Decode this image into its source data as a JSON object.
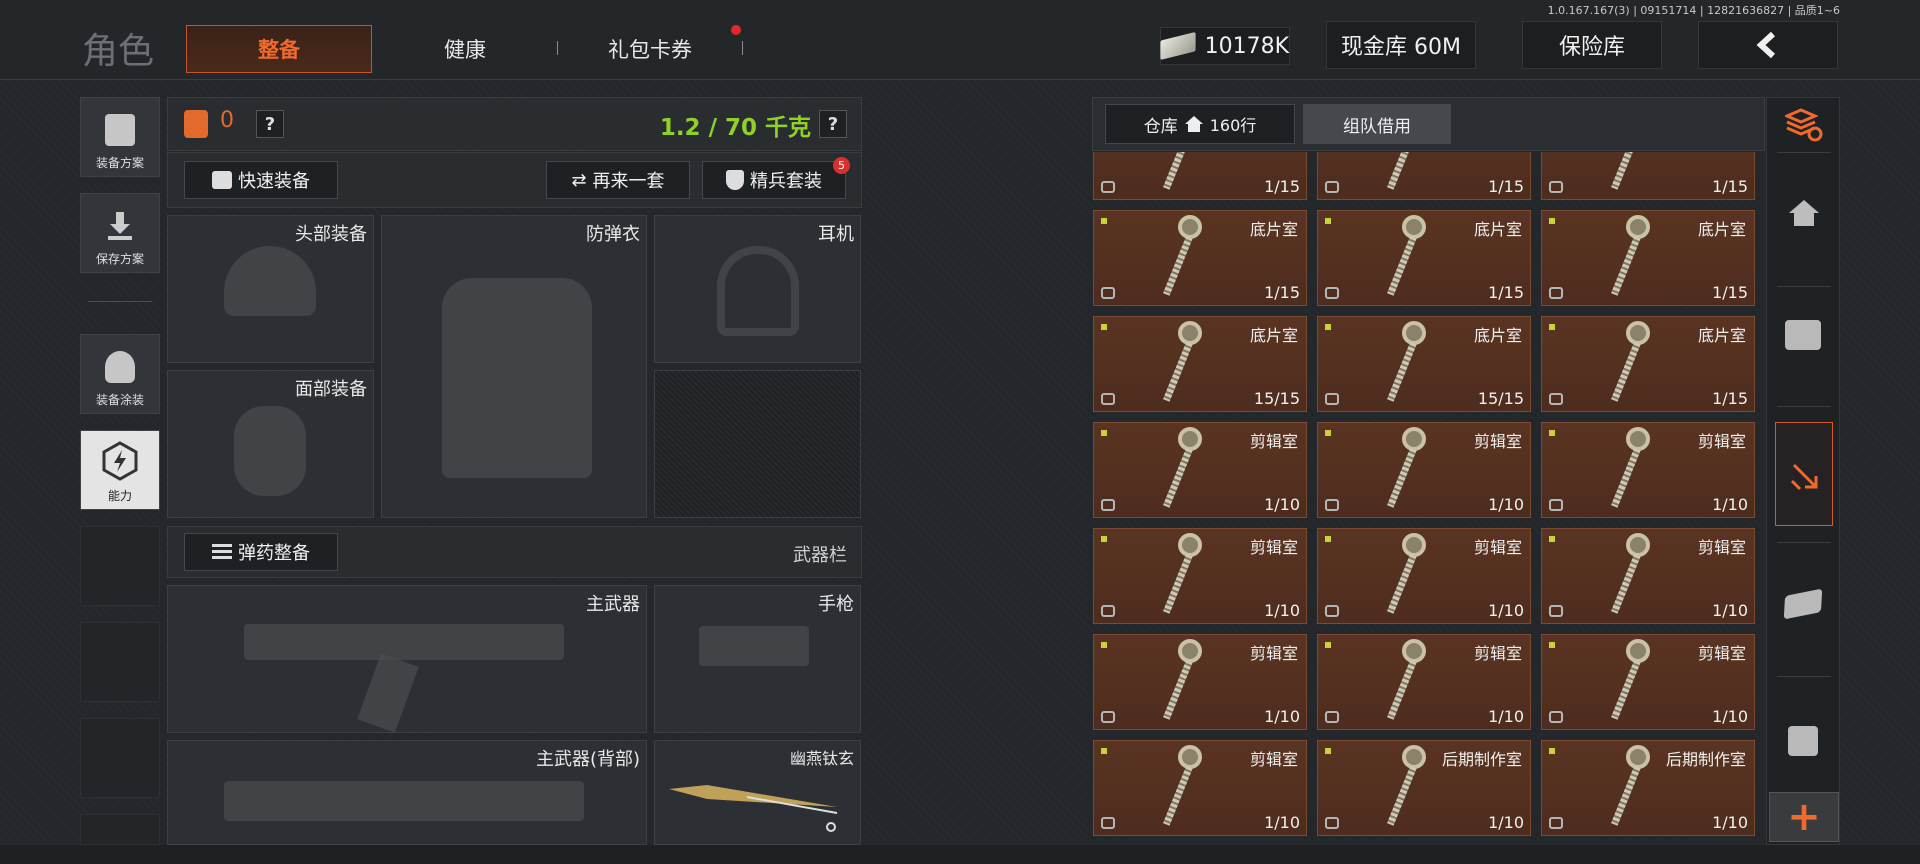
{
  "build_info": "1.0.167.167(3) | 09151714 | 12821636827 | 品质1~6",
  "header": {
    "title": "角色",
    "tabs": [
      {
        "label": "整备",
        "active": true
      },
      {
        "label": "健康"
      },
      {
        "label": "礼包卡券",
        "notify": true
      }
    ],
    "currency": "10178K",
    "cash_vault": "现金库 60M",
    "safe_vault": "保险库",
    "back_icon": "chevron-left-icon"
  },
  "side_nav": [
    {
      "label": "装备方案",
      "icon": "vest-icon"
    },
    {
      "label": "保存方案",
      "icon": "download-icon"
    },
    {
      "label": "装备涂装",
      "icon": "helmet-paint-icon"
    },
    {
      "label": "能力",
      "icon": "hex-lightning-icon",
      "active": true
    }
  ],
  "loadout": {
    "armor_count": "0",
    "help": "?",
    "weight": "1.2 / 70 千克",
    "quick_equip": "快速装备",
    "again": "再来一套",
    "elite": "精兵套装",
    "elite_badge": "5",
    "slots": {
      "head": "头部装备",
      "vest": "防弹衣",
      "headset": "耳机",
      "face": "面部装备"
    },
    "ammo_btn": "弹药整备",
    "weapons_label": "武器栏",
    "weapons": {
      "primary": "主武器",
      "pistol": "手枪",
      "primary_back": "主武器(背部)",
      "melee": "幽燕钛玄"
    }
  },
  "warehouse": {
    "tab_label": "仓库",
    "rows": "160行",
    "team_borrow": "组队借用",
    "items": [
      {
        "name": "",
        "count": "1/15"
      },
      {
        "name": "",
        "count": "1/15"
      },
      {
        "name": "",
        "count": "1/15"
      },
      {
        "name": "底片室",
        "count": "1/15"
      },
      {
        "name": "底片室",
        "count": "1/15"
      },
      {
        "name": "底片室",
        "count": "1/15"
      },
      {
        "name": "底片室",
        "count": "15/15"
      },
      {
        "name": "底片室",
        "count": "15/15"
      },
      {
        "name": "底片室",
        "count": "1/15"
      },
      {
        "name": "剪辑室",
        "count": "1/10"
      },
      {
        "name": "剪辑室",
        "count": "1/10"
      },
      {
        "name": "剪辑室",
        "count": "1/10"
      },
      {
        "name": "剪辑室",
        "count": "1/10"
      },
      {
        "name": "剪辑室",
        "count": "1/10"
      },
      {
        "name": "剪辑室",
        "count": "1/10"
      },
      {
        "name": "剪辑室",
        "count": "1/10"
      },
      {
        "name": "剪辑室",
        "count": "1/10"
      },
      {
        "name": "剪辑室",
        "count": "1/10"
      },
      {
        "name": "剪辑室",
        "count": "1/10"
      },
      {
        "name": "后期制作室",
        "count": "1/10"
      },
      {
        "name": "后期制作室",
        "count": "1/10"
      }
    ]
  },
  "right_rail": [
    {
      "icon": "stack-refresh-icon"
    },
    {
      "icon": "home-icon"
    },
    {
      "icon": "coins-icon"
    },
    {
      "icon": "sort-down-icon",
      "active": true
    },
    {
      "icon": "cash-icon"
    },
    {
      "icon": "box-icon"
    },
    {
      "icon": "plus-icon",
      "label": "+"
    }
  ],
  "colors": {
    "accent": "#f0692d",
    "weight": "#8fd128",
    "card": "#5a3422"
  }
}
